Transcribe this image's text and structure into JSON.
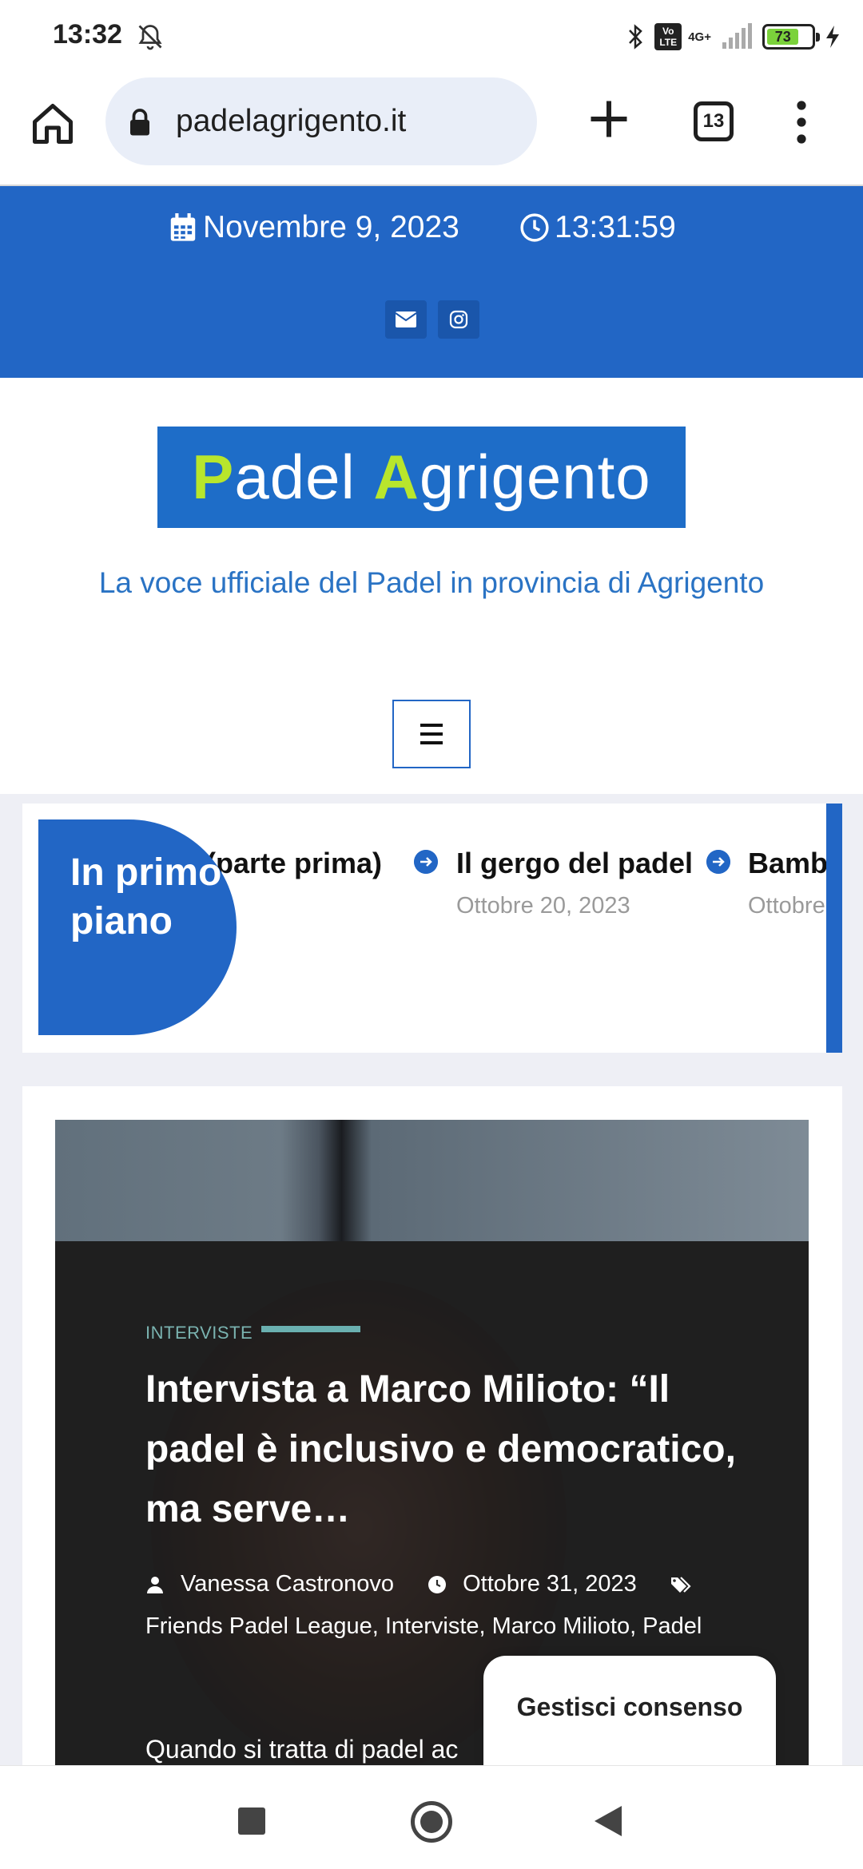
{
  "status_bar": {
    "time": "13:32",
    "network": "4G+",
    "volte": "Vo LTE",
    "battery_level": "73",
    "icons": [
      "bell-off-icon",
      "bluetooth-icon",
      "volte-icon",
      "signal-icon",
      "battery-icon",
      "charging-icon"
    ]
  },
  "browser": {
    "url": "padelagrigento.it",
    "tab_count": "13",
    "icons": [
      "home-icon",
      "lock-icon",
      "plus-icon",
      "tabs-icon",
      "menu-icon"
    ]
  },
  "topbar": {
    "date": "Novembre 9, 2023",
    "time": "13:31:59",
    "icons": [
      "calendar-icon",
      "clock-icon",
      "email-icon",
      "instagram-icon"
    ],
    "background": "#2266c5"
  },
  "header": {
    "logo_cap1": "P",
    "logo_text1": "adel ",
    "logo_cap2": "A",
    "logo_text2": "grigento",
    "tagline": "La voce ufficiale del Padel in provincia di Agrigento",
    "accent": "#b8e62c"
  },
  "ticker": {
    "label": "In primo piano",
    "items": [
      {
        "title": "(parte prima)",
        "date": ""
      },
      {
        "title": "Il gergo del padel",
        "date": "Ottobre 20, 2023"
      },
      {
        "title": "Bamb",
        "date": "Ottobre"
      }
    ]
  },
  "article": {
    "category": "INTERVISTE",
    "title": "Intervista a Marco Milioto: “Il padel è inclusivo e democratico, ma serve…",
    "author": "Vanessa Castronovo",
    "date": "Ottobre 31, 2023",
    "tags": "Friends Padel League, Interviste, Marco Milioto, Padel",
    "excerpt": "Quando si tratta di padel ac"
  },
  "consent": {
    "label": "Gestisci consenso"
  },
  "navbar": {
    "icons": [
      "recents-icon",
      "home-circle-icon",
      "back-icon"
    ]
  }
}
